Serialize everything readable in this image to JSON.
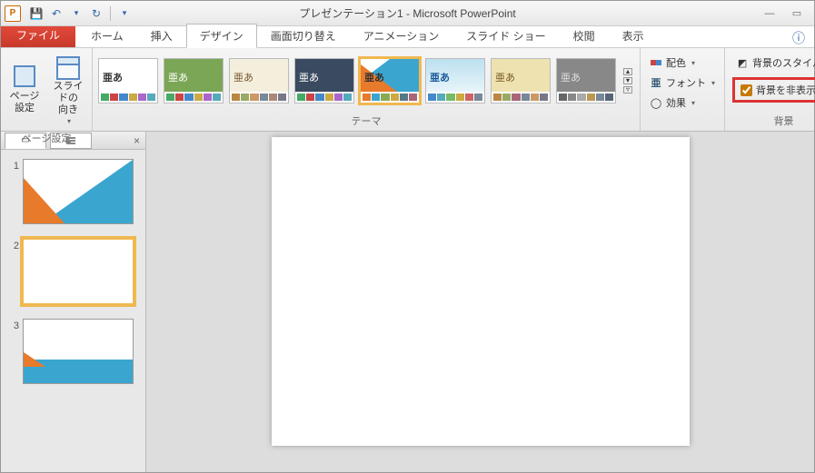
{
  "title": "プレゼンテーション1 - Microsoft PowerPoint",
  "qat": {
    "save_tip": "save",
    "undo_tip": "undo",
    "redo_tip": "redo"
  },
  "tabs": {
    "file": "ファイル",
    "items": [
      "ホーム",
      "挿入",
      "デザイン",
      "画面切り替え",
      "アニメーション",
      "スライド ショー",
      "校閲",
      "表示"
    ],
    "active_index": 2
  },
  "ribbon": {
    "page_setup": {
      "page": "ページ\n設定",
      "orient": "スライドの\n向き",
      "group_label": "ページ設定"
    },
    "themes": {
      "sample_text": "亜あ",
      "group_label": "テーマ"
    },
    "variants": {
      "colors": "配色",
      "fonts": "フォント",
      "effects": "効果"
    },
    "background": {
      "styles": "背景のスタイル",
      "hide": "背景を非表示",
      "group_label": "背景"
    }
  },
  "slides": [
    {
      "num": "1"
    },
    {
      "num": "2"
    },
    {
      "num": "3"
    }
  ]
}
